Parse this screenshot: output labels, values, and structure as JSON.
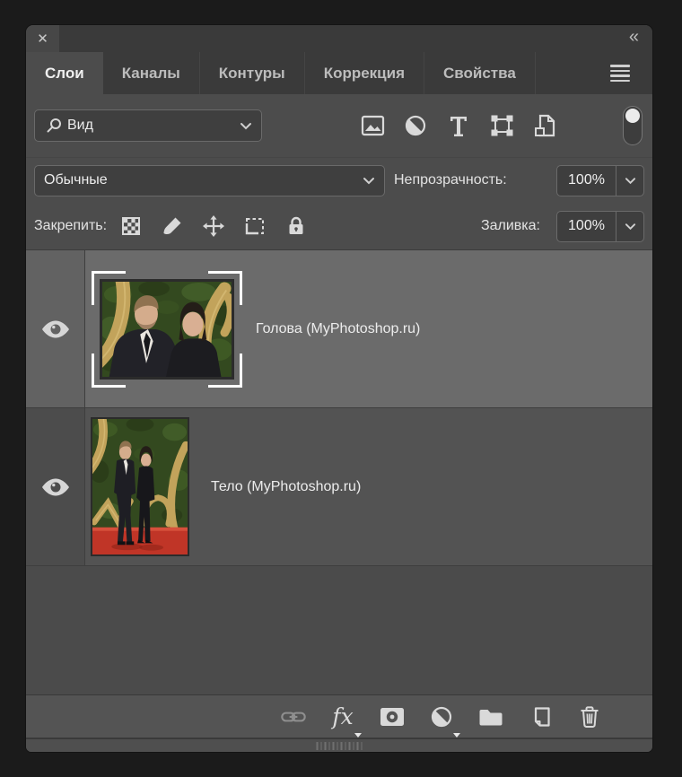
{
  "colors": {
    "panel_bg": "#4c4c4c",
    "selected_layer_bg": "#6b6b6b",
    "layer_bg": "#535353",
    "field_bg": "#3e3e3e",
    "text": "#ececec",
    "carpet_red": "#c03527",
    "hedge_green": "#33491f",
    "gold": "#c2a35b"
  },
  "titlebar": {
    "close_label": "✕",
    "collapse_label": "«"
  },
  "tabs": [
    {
      "label": "Слои",
      "active": true
    },
    {
      "label": "Каналы",
      "active": false
    },
    {
      "label": "Контуры",
      "active": false
    },
    {
      "label": "Коррекция",
      "active": false
    },
    {
      "label": "Свойства",
      "active": false
    }
  ],
  "filter_bar": {
    "kind_value": "Вид",
    "icons": [
      "search-icon",
      "pixel-layer-filter-icon",
      "adjustment-layer-filter-icon",
      "type-layer-filter-icon",
      "shape-layer-filter-icon",
      "smart-object-filter-icon",
      "layer-filter-toggle"
    ]
  },
  "blend_bar": {
    "mode_value": "Обычные",
    "opacity_label": "Непрозрачность:",
    "opacity_value": "100%"
  },
  "lock_bar": {
    "label": "Закрепить:",
    "icons": [
      "lock-transparency-icon",
      "lock-pixels-icon",
      "lock-position-icon",
      "lock-artboard-icon",
      "lock-all-icon"
    ],
    "fill_label": "Заливка:",
    "fill_value": "100%"
  },
  "layers": [
    {
      "name": "Голова (MyPhotoshop.ru)",
      "visible": true,
      "selected": true
    },
    {
      "name": "Тело (MyPhotoshop.ru)",
      "visible": true,
      "selected": false
    }
  ],
  "toolbar_icons": [
    "link-layers-icon",
    "layer-effects-icon",
    "add-layer-mask-icon",
    "new-adjustment-layer-icon",
    "new-group-icon",
    "new-layer-icon",
    "delete-layer-icon"
  ]
}
